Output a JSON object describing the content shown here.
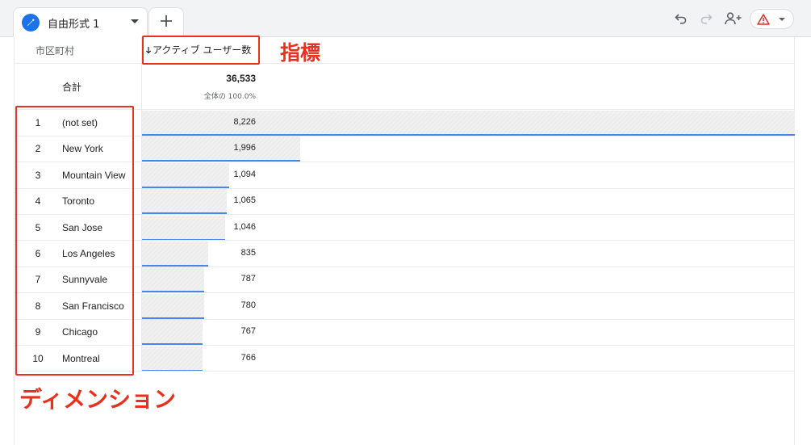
{
  "tab": {
    "label": "自由形式 1",
    "icon": "pencil-icon"
  },
  "toolbar": {
    "icons": [
      "undo-icon",
      "redo-icon",
      "share-user-icon",
      "warning-icon"
    ],
    "warning_color": "#d93025"
  },
  "table": {
    "dimension_header": "市区町村",
    "metric_header": "アクティブ ユーザー数",
    "sort_icon": "arrow-down-icon",
    "total_label": "合計",
    "total_value": "36,533",
    "total_percent": "全体の 100.0%",
    "bar_color": "#4a86e8",
    "rows": [
      {
        "rank": "1",
        "city": "(not set)",
        "value": "8,226",
        "share": 1.0
      },
      {
        "rank": "2",
        "city": "New York",
        "value": "1,996",
        "share": 0.2426
      },
      {
        "rank": "3",
        "city": "Mountain View",
        "value": "1,094",
        "share": 0.133
      },
      {
        "rank": "4",
        "city": "Toronto",
        "value": "1,065",
        "share": 0.1295
      },
      {
        "rank": "5",
        "city": "San Jose",
        "value": "1,046",
        "share": 0.1272
      },
      {
        "rank": "6",
        "city": "Los Angeles",
        "value": "835",
        "share": 0.1015
      },
      {
        "rank": "7",
        "city": "Sunnyvale",
        "value": "787",
        "share": 0.0957
      },
      {
        "rank": "8",
        "city": "San Francisco",
        "value": "780",
        "share": 0.0948
      },
      {
        "rank": "9",
        "city": "Chicago",
        "value": "767",
        "share": 0.0932
      },
      {
        "rank": "10",
        "city": "Montreal",
        "value": "766",
        "share": 0.0931
      }
    ]
  },
  "annotations": {
    "metric_label": "指標",
    "dimension_label": "ディメンション",
    "color": "#e8321f"
  }
}
